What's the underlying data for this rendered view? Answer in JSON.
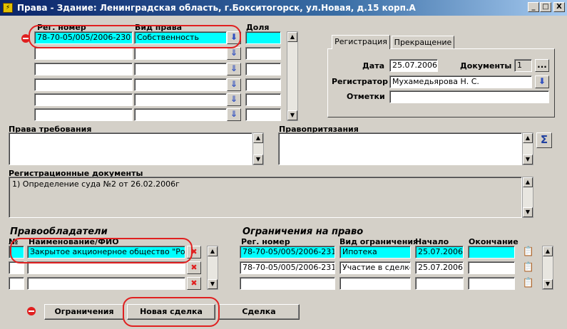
{
  "window": {
    "title": "Права - Здание: Ленинградская область, г.Бокситогорск, ул.Новая, д.15 корп.А",
    "app_icon": "app-icon",
    "controls": [
      "_",
      "□",
      "X"
    ]
  },
  "rights": {
    "col_reg": "Рег. номер",
    "col_type": "Вид права",
    "col_share": "Доля",
    "rows": [
      {
        "reg": "78-70-05/005/2006-230",
        "type": "Собственность",
        "share": ""
      },
      {
        "reg": "",
        "type": "",
        "share": ""
      },
      {
        "reg": "",
        "type": "",
        "share": ""
      },
      {
        "reg": "",
        "type": "",
        "share": ""
      },
      {
        "reg": "",
        "type": "",
        "share": ""
      },
      {
        "reg": "",
        "type": "",
        "share": ""
      }
    ]
  },
  "tabs": {
    "registration": "Регистрация",
    "termination": "Прекращение"
  },
  "registration": {
    "date_label": "Дата",
    "date_value": "25.07.2006",
    "docs_label": "Документы",
    "docs_value": "1",
    "docs_button": "...",
    "registrar_label": "Регистратор",
    "registrar_value": "Мухамедьярова Н. С.",
    "notes_label": "Отметки",
    "notes_value": ""
  },
  "claims": {
    "label": "Права требования",
    "value": ""
  },
  "pretensions": {
    "label": "Правопритязания",
    "value": "",
    "sum_button": "Σ"
  },
  "reg_docs": {
    "label": "Регистрационные документы",
    "value": "1) Определение суда №2 от 26.02.2006г"
  },
  "holders": {
    "section_title": "Правообладатели",
    "col_no": "№",
    "col_name": "Наименование/ФИО",
    "rows": [
      {
        "no": "",
        "name": "Закрытое акционерное общество \"Рома"
      },
      {
        "no": "",
        "name": ""
      },
      {
        "no": "",
        "name": ""
      }
    ]
  },
  "restrictions": {
    "section_title": "Ограничения на право",
    "col_reg": "Рег. номер",
    "col_type": "Вид ограничения",
    "col_start": "Начало",
    "col_end": "Окончание",
    "rows": [
      {
        "reg": "78-70-05/005/2006-231",
        "type": "Ипотека",
        "start": "25.07.2006",
        "end": ""
      },
      {
        "reg": "78-70-05/005/2006-231",
        "type": "Участие в сделке",
        "start": "25.07.2006",
        "end": ""
      },
      {
        "reg": "",
        "type": "",
        "start": "",
        "end": ""
      }
    ]
  },
  "buttons": {
    "restrictions": "Ограничения",
    "new_deal": "Новая сделка",
    "deal": "Сделка"
  },
  "colors": {
    "highlight": "#00ffff",
    "annotation": "#e02020"
  }
}
